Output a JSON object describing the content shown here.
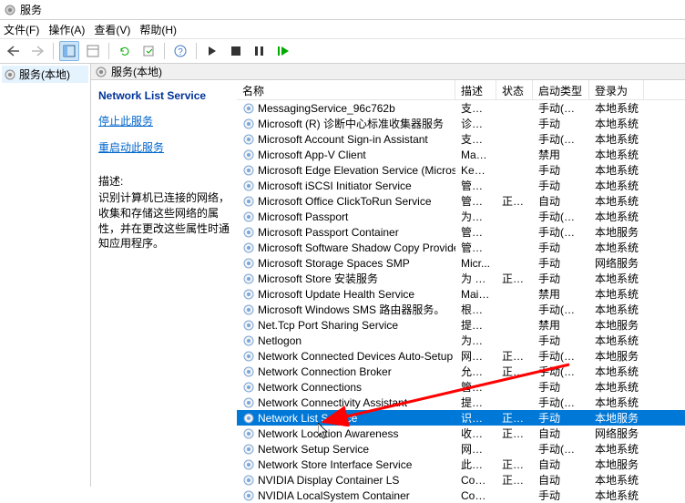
{
  "window": {
    "title": "服务"
  },
  "menu": {
    "file": "文件(F)",
    "action": "操作(A)",
    "view": "查看(V)",
    "help": "帮助(H)"
  },
  "tree": {
    "root": "服务(本地)"
  },
  "contentHeader": "服务(本地)",
  "detail": {
    "title": "Network List Service",
    "stopLink": "停止此服务",
    "restartLink": "重启动此服务",
    "descLabel": "描述:",
    "desc": "识别计算机已连接的网络，收集和存储这些网络的属性，并在更改这些属性时通知应用程序。"
  },
  "columns": {
    "name": "名称",
    "desc": "描述",
    "status": "状态",
    "startup": "启动类型",
    "logon": "登录为"
  },
  "rows": [
    {
      "name": "MessagingService_96c762b",
      "desc": "支持...",
      "status": "",
      "startup": "手动(触发...",
      "logon": "本地系统"
    },
    {
      "name": "Microsoft (R) 诊断中心标准收集器服务",
      "desc": "诊断...",
      "status": "",
      "startup": "手动",
      "logon": "本地系统"
    },
    {
      "name": "Microsoft Account Sign-in Assistant",
      "desc": "支持...",
      "status": "",
      "startup": "手动(触发...",
      "logon": "本地系统"
    },
    {
      "name": "Microsoft App-V Client",
      "desc": "Man...",
      "status": "",
      "startup": "禁用",
      "logon": "本地系统"
    },
    {
      "name": "Microsoft Edge Elevation Service (MicrosoftEdgeEle...",
      "desc": "Keep...",
      "status": "",
      "startup": "手动",
      "logon": "本地系统"
    },
    {
      "name": "Microsoft iSCSI Initiator Service",
      "desc": "管理...",
      "status": "",
      "startup": "手动",
      "logon": "本地系统"
    },
    {
      "name": "Microsoft Office ClickToRun Service",
      "desc": "管理...",
      "status": "正在...",
      "startup": "自动",
      "logon": "本地系统"
    },
    {
      "name": "Microsoft Passport",
      "desc": "为用...",
      "status": "",
      "startup": "手动(触发...",
      "logon": "本地系统"
    },
    {
      "name": "Microsoft Passport Container",
      "desc": "管理...",
      "status": "",
      "startup": "手动(触发...",
      "logon": "本地服务"
    },
    {
      "name": "Microsoft Software Shadow Copy Provider",
      "desc": "管理...",
      "status": "",
      "startup": "手动",
      "logon": "本地系统"
    },
    {
      "name": "Microsoft Storage Spaces SMP",
      "desc": "Micr...",
      "status": "",
      "startup": "手动",
      "logon": "网络服务"
    },
    {
      "name": "Microsoft Store 安装服务",
      "desc": "为 M...",
      "status": "正在...",
      "startup": "手动",
      "logon": "本地系统"
    },
    {
      "name": "Microsoft Update Health Service",
      "desc": "Main...",
      "status": "",
      "startup": "禁用",
      "logon": "本地系统"
    },
    {
      "name": "Microsoft Windows SMS 路由器服务。",
      "desc": "根据...",
      "status": "",
      "startup": "手动(触发...",
      "logon": "本地系统"
    },
    {
      "name": "Net.Tcp Port Sharing Service",
      "desc": "提供...",
      "status": "",
      "startup": "禁用",
      "logon": "本地服务"
    },
    {
      "name": "Netlogon",
      "desc": "为用...",
      "status": "",
      "startup": "手动",
      "logon": "本地系统"
    },
    {
      "name": "Network Connected Devices Auto-Setup",
      "desc": "网络...",
      "status": "正在...",
      "startup": "手动(触发...",
      "logon": "本地服务"
    },
    {
      "name": "Network Connection Broker",
      "desc": "允许...",
      "status": "正在...",
      "startup": "手动(触发...",
      "logon": "本地系统"
    },
    {
      "name": "Network Connections",
      "desc": "管理\"...",
      "status": "",
      "startup": "手动",
      "logon": "本地系统"
    },
    {
      "name": "Network Connectivity Assistant",
      "desc": "提供...",
      "status": "",
      "startup": "手动(触发...",
      "logon": "本地系统"
    },
    {
      "name": "Network List Service",
      "desc": "识别...",
      "status": "正在...",
      "startup": "手动",
      "logon": "本地服务",
      "selected": true
    },
    {
      "name": "Network Location Awareness",
      "desc": "收集...",
      "status": "正在...",
      "startup": "自动",
      "logon": "网络服务"
    },
    {
      "name": "Network Setup Service",
      "desc": "网络...",
      "status": "",
      "startup": "手动(触发...",
      "logon": "本地系统"
    },
    {
      "name": "Network Store Interface Service",
      "desc": "此服...",
      "status": "正在...",
      "startup": "自动",
      "logon": "本地服务"
    },
    {
      "name": "NVIDIA Display Container LS",
      "desc": "Cont...",
      "status": "正在...",
      "startup": "自动",
      "logon": "本地系统"
    },
    {
      "name": "NVIDIA LocalSystem Container",
      "desc": "Cont...",
      "status": "",
      "startup": "手动",
      "logon": "本地系统"
    }
  ]
}
